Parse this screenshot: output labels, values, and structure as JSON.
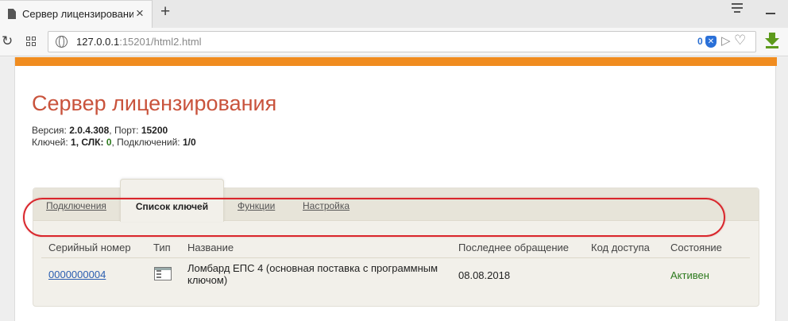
{
  "browser": {
    "tab_title": "Сервер лицензирования",
    "tab_close": "×",
    "new_tab": "+",
    "reload": "↻",
    "url_host": "127.0.0.1",
    "url_rest": ":15201/html2.html",
    "adblock_count": "0",
    "adblock_mark": "✕",
    "send_glyph": "▷",
    "heart_glyph": "♡",
    "download_color": "#5d9a1c"
  },
  "page": {
    "accent_color": "#f08c1f",
    "title": "Сервер лицензирования",
    "info": {
      "version_label": "Версия: ",
      "version": "2.0.4.308",
      "port_label": ", Порт: ",
      "port": "15200",
      "keys_label": "Ключей: ",
      "keys": "1,",
      "slk_label": " СЛК: ",
      "slk": "0",
      "conn_label": ", Подключений: ",
      "conn": "1/0"
    },
    "tabs": [
      {
        "label": "Подключения",
        "active": false
      },
      {
        "label": "Список ключей",
        "active": true
      },
      {
        "label": "Функции",
        "active": false
      },
      {
        "label": "Настройка",
        "active": false
      }
    ],
    "table": {
      "columns": [
        "Серийный номер",
        "Тип",
        "Название",
        "Последнее обращение",
        "Код доступа",
        "Состояние"
      ],
      "rows": [
        {
          "serial": "0000000004",
          "type_icon": "key-card-icon",
          "name": "Ломбард ЕПС 4 (основная поставка с программным ключом)",
          "last_call": "08.08.2018",
          "access_code": "",
          "status": "Активен"
        }
      ]
    }
  }
}
